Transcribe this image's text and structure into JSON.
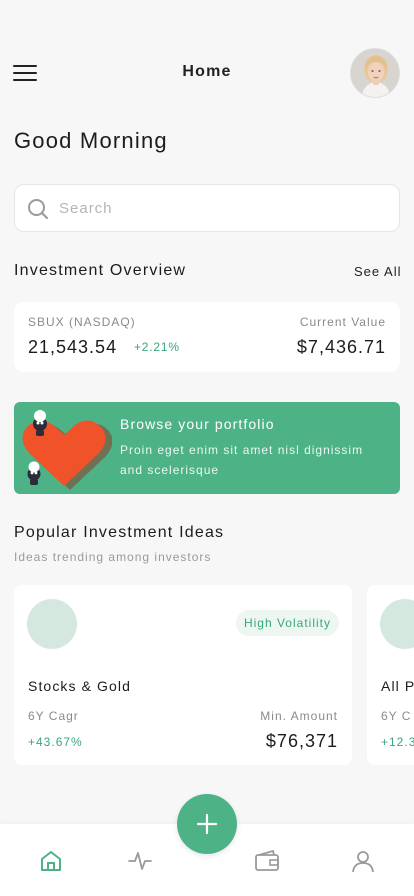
{
  "header": {
    "title": "Home",
    "menu_icon": "hamburger-menu-icon",
    "avatar_icon": "user-avatar"
  },
  "greeting": "Good Morning",
  "search": {
    "placeholder": "Search",
    "value": ""
  },
  "overview": {
    "title": "Investment Overview",
    "see_all": "See All",
    "holding": {
      "symbol": "SBUX (NASDAQ)",
      "price": "21,543.54",
      "change": "+2.21%",
      "value_label": "Current Value",
      "value": "$7,436.71"
    }
  },
  "promo": {
    "title": "Browse your portfolio",
    "text": "Proin eget enim sit amet nisl dignissim and scelerisque",
    "illustration": "heart-with-characters-illustration"
  },
  "ideas": {
    "title": "Popular Investment Ideas",
    "subtitle": "Ideas trending among investors",
    "cards": [
      {
        "badge": "High Volatility",
        "name": "Stocks & Gold",
        "cagr_label": "6Y Cagr",
        "cagr": "+43.67%",
        "min_label": "Min. Amount",
        "min": "$76,371"
      },
      {
        "name": "All P",
        "cagr_label": "6Y C",
        "cagr": "+12.3"
      }
    ]
  },
  "nav": {
    "items": [
      "home-icon",
      "activity-icon",
      "wallet-icon",
      "profile-icon"
    ],
    "fab_icon": "plus-icon"
  },
  "colors": {
    "accent": "#4db386",
    "positive": "#3aa67a",
    "background": "#f7f7f7"
  }
}
